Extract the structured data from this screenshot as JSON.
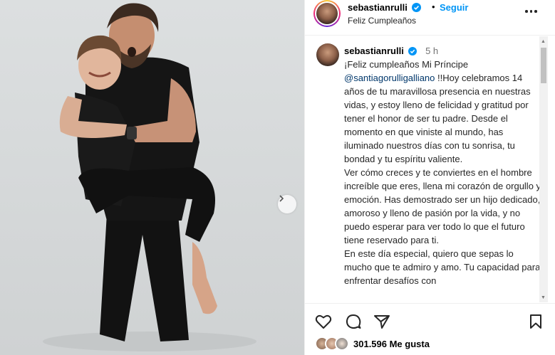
{
  "post": {
    "username": "sebastianrulli",
    "separator": "•",
    "follow_label": "Seguir",
    "subtitle": "Feliz Cumpleaños",
    "time": "5 h",
    "caption": {
      "p1_pre": "¡Feliz cumpleaños Mi Príncipe",
      "mention": "@santiagorulligalliano",
      "p1_post": "!!Hoy celebramos 14 años de tu maravillosa presencia en nuestras vidas, y estoy lleno de felicidad y gratitud por tener el honor de ser tu padre. Desde el momento en que viniste al mundo, has iluminado nuestros días con tu sonrisa, tu bondad y tu espíritu valiente.",
      "p2": "Ver cómo creces y te conviertes en el hombre increíble que eres, llena mi corazón de orgullo y emoción. Has demostrado ser un hijo dedicado, amoroso y lleno de pasión por la vida, y no puedo esperar para ver todo lo que el futuro tiene reservado para ti.",
      "p3": "En este día especial, quiero que sepas lo mucho que te admiro y amo. Tu capacidad para enfrentar desafíos con"
    },
    "likes": "301.596 Me gusta"
  },
  "icons": {
    "verified": "verified-badge-icon",
    "more": "more-options-icon",
    "like": "heart-icon",
    "comment": "comment-icon",
    "share": "send-icon",
    "save": "bookmark-icon",
    "next": "chevron-right-icon"
  },
  "colors": {
    "link": "#0095f6",
    "mention": "#00376b",
    "muted": "#737373"
  }
}
